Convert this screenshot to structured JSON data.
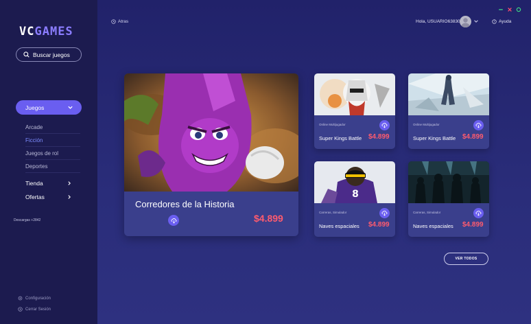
{
  "brand": {
    "part1": "VC",
    "part2": "GAMES"
  },
  "sidebar": {
    "search_label": "Buscar juegos",
    "juegos_label": "Juegos",
    "sub_items": [
      "Arcade",
      "Ficción",
      "Juegos de rol",
      "Deportes"
    ],
    "active_sub_item": "Ficción",
    "nav_items": [
      "Tienda",
      "Ofertas"
    ],
    "footer": {
      "config_label": "Configuración",
      "logout_label": "Cerrar Sesión"
    }
  },
  "topbar": {
    "back_label": "Atras",
    "greeting": "Hola, USUARIO63830",
    "help_label": "Ayuda"
  },
  "featured": {
    "title": "Corredores de la Historia",
    "meta": "Descargas +2842",
    "price": "$4.899"
  },
  "cards": [
    {
      "tags": "Online Multijugador",
      "title": "Super Kings Battle",
      "price": "$4.899",
      "icon": "download-icon"
    },
    {
      "tags": "Online Multijugador",
      "title": "Super Kings Battle",
      "price": "$4.899",
      "icon": "download-icon"
    },
    {
      "tags": "Carreras, Simulador",
      "title": "Naves espaciales",
      "price": "$4.899",
      "icon": "download-icon"
    },
    {
      "tags": "Carreras, Simulador",
      "title": "Naves espaciales",
      "price": "$4.899",
      "icon": "download-icon"
    }
  ],
  "ver_todos_label": "VER TODOS",
  "colors": {
    "accent": "#6a5ef0",
    "price": "#ff5b6e",
    "sidebar_bg": "#1c1b4f",
    "card_bg": "#3a3f8c",
    "window_min": "#3ddc84",
    "window_close": "#ff4d6d",
    "window_max": "#3ddc84"
  }
}
